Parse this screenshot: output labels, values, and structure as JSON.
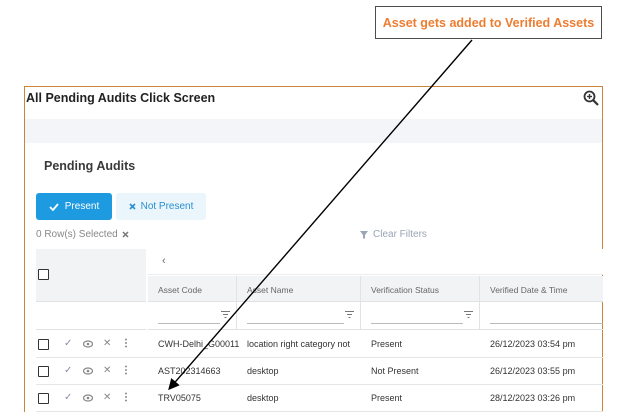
{
  "annotation": {
    "callout_text": "Asset gets added to Verified Assets"
  },
  "window": {
    "title": "All Pending Audits Click Screen"
  },
  "section": {
    "title": "Pending Audits"
  },
  "buttons": {
    "present_label": "Present",
    "not_present_label": "Not Present"
  },
  "toolbar": {
    "rows_selected": "0 Row(s) Selected",
    "clear_filters": "Clear Filters"
  },
  "table": {
    "columns": [
      "Asset Code",
      "Asset Name",
      "Verification Status",
      "Verified Date & Time"
    ],
    "rows": [
      {
        "asset_code": "CWH-Delhi_G00011",
        "asset_name": "location right category not",
        "status": "Present",
        "verified": "26/12/2023 03:54 pm"
      },
      {
        "asset_code": "AST202314663",
        "asset_name": "desktop",
        "status": "Not Present",
        "verified": "26/12/2023 03:55 pm"
      },
      {
        "asset_code": "TRV05075",
        "asset_name": "desktop",
        "status": "Present",
        "verified": "28/12/2023 03:26 pm"
      }
    ]
  },
  "colors": {
    "accent": "#1e9ae0",
    "callout_text": "#ed7d31",
    "frame_border": "#c9863a"
  }
}
